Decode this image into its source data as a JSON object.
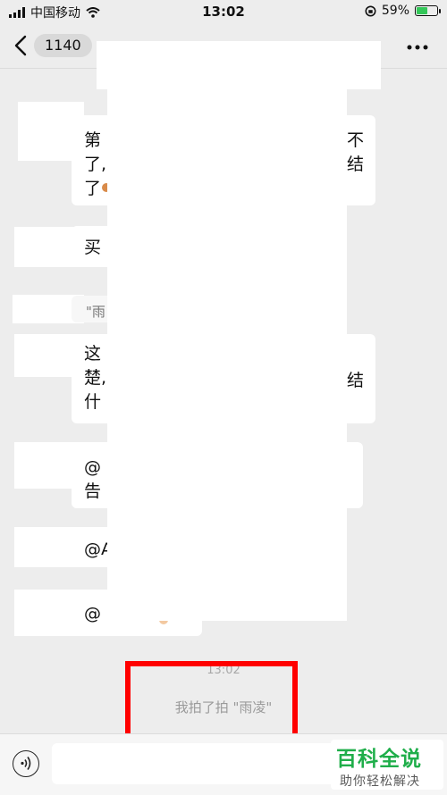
{
  "status_bar": {
    "carrier": "中国移动",
    "time": "13:02",
    "battery_percent": "59%",
    "battery_level": 0.59
  },
  "nav": {
    "unread_count": "1140"
  },
  "messages": {
    "m1_line1_start": "第",
    "m1_line1_end": "不",
    "m1_line2_start": "了,",
    "m1_line2_end": "结",
    "m1_line3_start": "了",
    "m2_start": "买",
    "m3_quote": "\"雨",
    "m4_line1_start": "这",
    "m4_line2_start": "楚,",
    "m4_line2_end": "结",
    "m4_line3_start": "什",
    "m5_line1_start": "@",
    "m5_line2_start": "告",
    "m6_start": "@A",
    "m7_start": "@"
  },
  "system": {
    "timestamp": "13:02",
    "pat_notice": "我拍了拍 \"雨凌\""
  },
  "watermark": {
    "title": "百科全说",
    "subtitle": "助你轻松解决"
  },
  "colors": {
    "highlight": "#ff0000",
    "watermark_green": "#1fae4a"
  }
}
